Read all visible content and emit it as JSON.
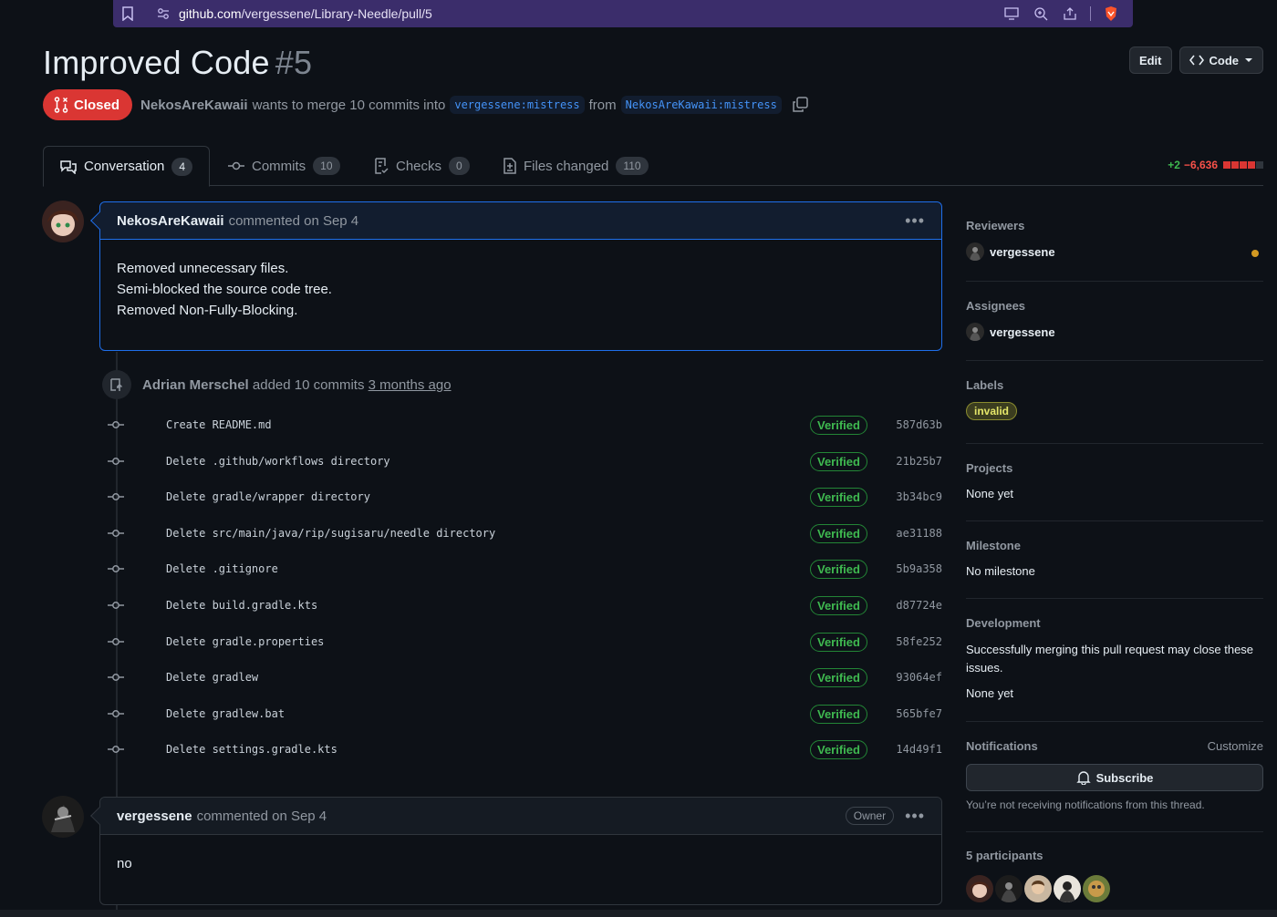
{
  "browser": {
    "url_host": "github.com",
    "url_path": "/vergessene/Library-Needle/pull/5"
  },
  "pr": {
    "title": "Improved Code",
    "number": "#5",
    "state": "Closed",
    "author": "NekosAreKawaii",
    "merge_text": "wants to merge 10 commits into",
    "base_branch": "vergessene:mistress",
    "from_text": "from",
    "head_branch": "NekosAreKawaii:mistress",
    "edit_label": "Edit",
    "code_label": "Code"
  },
  "tabs": [
    {
      "label": "Conversation",
      "count": "4",
      "icon": "comment-discussion-icon"
    },
    {
      "label": "Commits",
      "count": "10",
      "icon": "commit-icon"
    },
    {
      "label": "Checks",
      "count": "0",
      "icon": "checklist-icon"
    },
    {
      "label": "Files changed",
      "count": "110",
      "icon": "file-diff-icon"
    }
  ],
  "diffstat": {
    "additions": "+2",
    "deletions": "−6,636"
  },
  "first_comment": {
    "author": "NekosAreKawaii",
    "meta": "commented on Sep 4",
    "lines": [
      "Removed unnecessary files.",
      "Semi-blocked the source code tree.",
      "Removed Non-Fully-Blocking."
    ]
  },
  "push_event": {
    "actor": "Adrian Merschel",
    "text": "added 10 commits",
    "when": "3 months ago"
  },
  "commits": [
    {
      "message": "Create README.md",
      "verified": "Verified",
      "sha": "587d63b"
    },
    {
      "message": "Delete .github/workflows directory",
      "verified": "Verified",
      "sha": "21b25b7"
    },
    {
      "message": "Delete gradle/wrapper directory",
      "verified": "Verified",
      "sha": "3b34bc9"
    },
    {
      "message": "Delete src/main/java/rip/sugisaru/needle directory",
      "verified": "Verified",
      "sha": "ae31188"
    },
    {
      "message": "Delete .gitignore",
      "verified": "Verified",
      "sha": "5b9a358"
    },
    {
      "message": "Delete build.gradle.kts",
      "verified": "Verified",
      "sha": "d87724e"
    },
    {
      "message": "Delete gradle.properties",
      "verified": "Verified",
      "sha": "58fe252"
    },
    {
      "message": "Delete gradlew",
      "verified": "Verified",
      "sha": "93064ef"
    },
    {
      "message": "Delete gradlew.bat",
      "verified": "Verified",
      "sha": "565bfe7"
    },
    {
      "message": "Delete settings.gradle.kts",
      "verified": "Verified",
      "sha": "14d49f1"
    }
  ],
  "second_comment": {
    "author": "vergessene",
    "meta": "commented on Sep 4",
    "badge": "Owner",
    "body": "no"
  },
  "sidebar": {
    "reviewers_h": "Reviewers",
    "reviewer": "vergessene",
    "assignees_h": "Assignees",
    "assignee": "vergessene",
    "labels_h": "Labels",
    "label": "invalid",
    "projects_h": "Projects",
    "projects_v": "None yet",
    "milestone_h": "Milestone",
    "milestone_v": "No milestone",
    "development_h": "Development",
    "development_text": "Successfully merging this pull request may close these issues.",
    "development_v": "None yet",
    "notifications_h": "Notifications",
    "customize": "Customize",
    "subscribe": "Subscribe",
    "notif_text": "You’re not receiving notifications from this thread.",
    "participants_h": "5 participants"
  },
  "colors": {
    "closed": "#da3633",
    "verified": "#3fb950",
    "link": "#4493f8",
    "label_invalid": "#e4e669"
  }
}
